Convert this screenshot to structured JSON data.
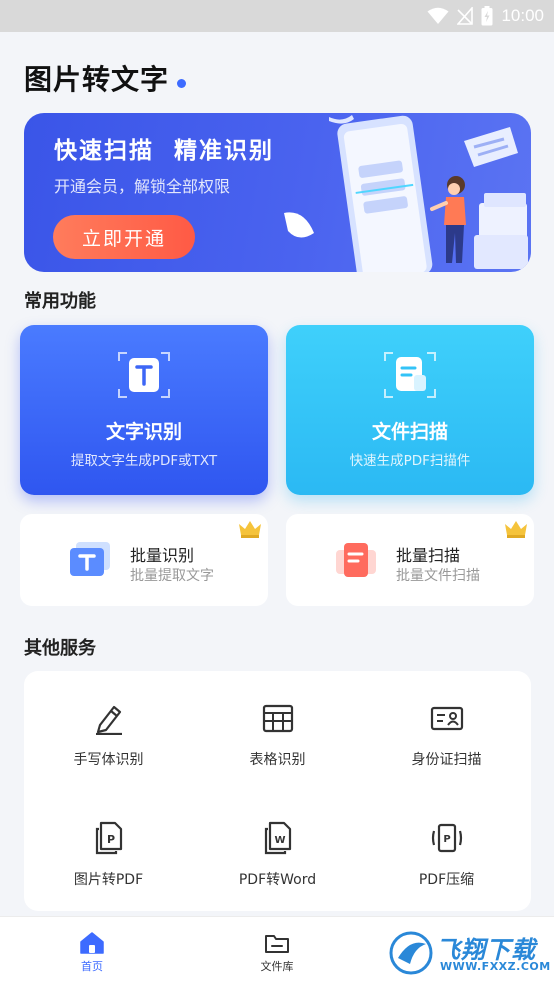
{
  "status_bar": {
    "time": "10:00",
    "icons": [
      "wifi-icon",
      "signal-icon",
      "battery-icon"
    ]
  },
  "page": {
    "title": "图片转文字"
  },
  "banner": {
    "headline": "快速扫描  精准识别",
    "subtitle": "开通会员，解锁全部权限",
    "button_label": "立即开通"
  },
  "common": {
    "section_title": "常用功能",
    "features": [
      {
        "name": "文字识别",
        "desc": "提取文字生成PDF或TXT",
        "icon": "text-scan-icon",
        "color": "#3d66f6"
      },
      {
        "name": "文件扫描",
        "desc": "快速生成PDF扫描件",
        "icon": "doc-scan-icon",
        "color": "#33c3f7"
      }
    ],
    "mini": [
      {
        "name": "批量识别",
        "desc": "批量提取文字",
        "icon": "batch-ocr-icon",
        "badge": "crown-icon"
      },
      {
        "name": "批量扫描",
        "desc": "批量文件扫描",
        "icon": "batch-scan-icon",
        "badge": "crown-icon"
      }
    ]
  },
  "other": {
    "section_title": "其他服务",
    "services": [
      {
        "label": "手写体识别",
        "icon": "pen-icon"
      },
      {
        "label": "表格识别",
        "icon": "table-icon"
      },
      {
        "label": "身份证扫描",
        "icon": "id-card-icon"
      },
      {
        "label": "图片转PDF",
        "icon": "pdf-file-icon"
      },
      {
        "label": "PDF转Word",
        "icon": "word-file-icon"
      },
      {
        "label": "PDF压缩",
        "icon": "compress-icon"
      }
    ]
  },
  "tabbar": {
    "tabs": [
      {
        "label": "首页",
        "icon": "home-icon",
        "active": true
      },
      {
        "label": "文件库",
        "icon": "folder-icon",
        "active": false
      }
    ]
  },
  "watermark": {
    "text": "飞翔下载",
    "url": "WWW.FXXZ.COM"
  },
  "colors": {
    "accent": "#3d6bff",
    "banner": "#4a63ef",
    "cta": "#ff6a4f",
    "crown": "#f5c33b"
  }
}
